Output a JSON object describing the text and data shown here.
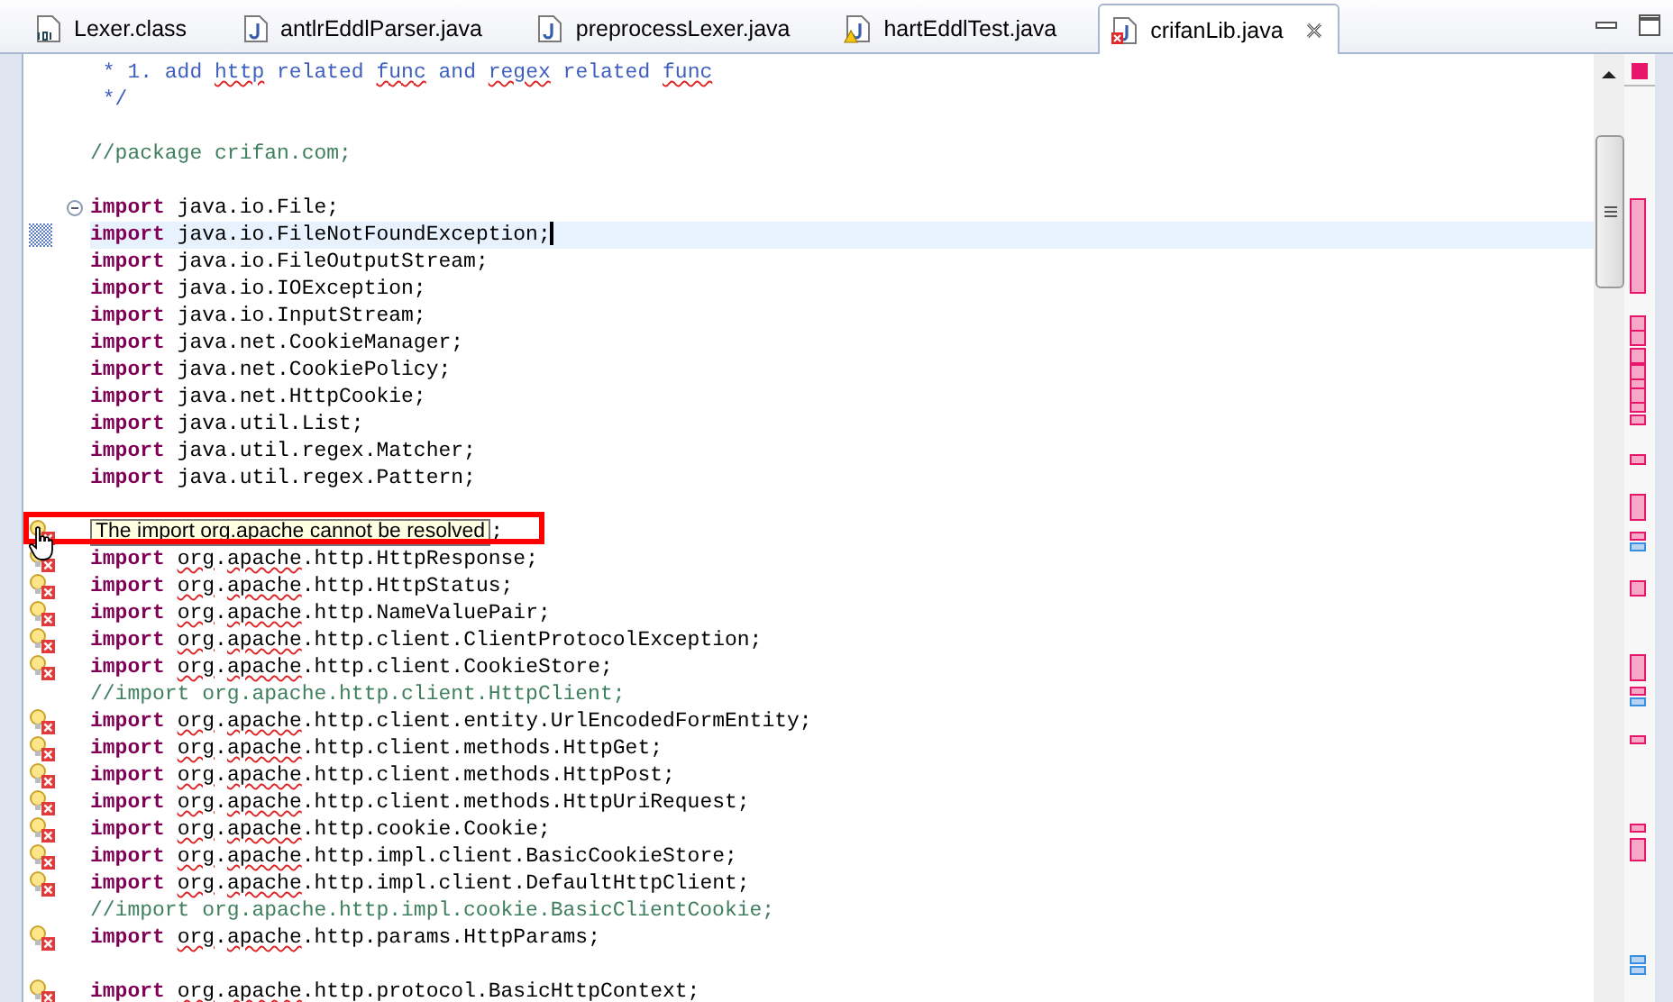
{
  "tabs": [
    {
      "label": "Lexer.class",
      "kind": "class",
      "selected": false
    },
    {
      "label": "antlrEddlParser.java",
      "kind": "java",
      "selected": false
    },
    {
      "label": "preprocessLexer.java",
      "kind": "java",
      "selected": false
    },
    {
      "label": "hartEddlTest.java",
      "kind": "java_warning",
      "selected": false
    },
    {
      "label": "crifanLib.java",
      "kind": "java_error",
      "selected": true
    }
  ],
  "editor": {
    "lines": [
      {
        "kind": "code",
        "current": false,
        "segments": [
          {
            "text": " * 1. add ",
            "kind": "doc"
          },
          {
            "text": "http",
            "kind": "doc_misspelled"
          },
          {
            "text": " related ",
            "kind": "doc"
          },
          {
            "text": "func",
            "kind": "doc_misspelled"
          },
          {
            "text": " and ",
            "kind": "doc"
          },
          {
            "text": "regex",
            "kind": "doc_misspelled"
          },
          {
            "text": " related ",
            "kind": "doc"
          },
          {
            "text": "func",
            "kind": "doc_misspelled"
          }
        ]
      },
      {
        "kind": "code",
        "current": false,
        "segments": [
          {
            "text": " */",
            "kind": "doc"
          }
        ]
      },
      {
        "kind": "blank",
        "current": false
      },
      {
        "kind": "code",
        "current": false,
        "segments": [
          {
            "text": "//package crifan.com;",
            "kind": "comment"
          }
        ]
      },
      {
        "kind": "blank",
        "current": false
      },
      {
        "kind": "code",
        "current": false,
        "gutter": {
          "kind": "fold"
        },
        "segments": [
          {
            "text": "import ",
            "kind": "keyword"
          },
          {
            "text": "java.io.File;",
            "kind": "plain"
          }
        ]
      },
      {
        "kind": "code",
        "current": true,
        "gutter": {
          "kind": "changed"
        },
        "segments": [
          {
            "text": "import ",
            "kind": "keyword"
          },
          {
            "text": "java.io.FileNotFoundException;",
            "kind": "plain"
          }
        ]
      },
      {
        "kind": "code",
        "current": false,
        "segments": [
          {
            "text": "import ",
            "kind": "keyword"
          },
          {
            "text": "java.io.FileOutputStream;",
            "kind": "plain"
          }
        ]
      },
      {
        "kind": "code",
        "current": false,
        "segments": [
          {
            "text": "import ",
            "kind": "keyword"
          },
          {
            "text": "java.io.IOException;",
            "kind": "plain"
          }
        ]
      },
      {
        "kind": "code",
        "current": false,
        "segments": [
          {
            "text": "import ",
            "kind": "keyword"
          },
          {
            "text": "java.io.InputStream;",
            "kind": "plain"
          }
        ]
      },
      {
        "kind": "code",
        "current": false,
        "segments": [
          {
            "text": "import ",
            "kind": "keyword"
          },
          {
            "text": "java.net.CookieManager;",
            "kind": "plain"
          }
        ]
      },
      {
        "kind": "code",
        "current": false,
        "segments": [
          {
            "text": "import ",
            "kind": "keyword"
          },
          {
            "text": "java.net.CookiePolicy;",
            "kind": "plain"
          }
        ]
      },
      {
        "kind": "code",
        "current": false,
        "segments": [
          {
            "text": "import ",
            "kind": "keyword"
          },
          {
            "text": "java.net.HttpCookie;",
            "kind": "plain"
          }
        ]
      },
      {
        "kind": "code",
        "current": false,
        "segments": [
          {
            "text": "import ",
            "kind": "keyword"
          },
          {
            "text": "java.util.List;",
            "kind": "plain"
          }
        ]
      },
      {
        "kind": "code",
        "current": false,
        "segments": [
          {
            "text": "import ",
            "kind": "keyword"
          },
          {
            "text": "java.util.regex.Matcher;",
            "kind": "plain"
          }
        ]
      },
      {
        "kind": "code",
        "current": false,
        "segments": [
          {
            "text": "import ",
            "kind": "keyword"
          },
          {
            "text": "java.util.regex.Pattern;",
            "kind": "plain"
          }
        ]
      },
      {
        "kind": "blank",
        "current": false
      },
      {
        "kind": "tooltip",
        "current": false,
        "gutter": {
          "kind": "error"
        },
        "tooltip": "The import org.apache cannot be resolved",
        "segments": [
          {
            "text": ";",
            "kind": "plain"
          }
        ]
      },
      {
        "kind": "code",
        "current": false,
        "gutter": {
          "kind": "error"
        },
        "segments": [
          {
            "text": "import ",
            "kind": "keyword"
          },
          {
            "text": "org",
            "kind": "misspelled"
          },
          {
            "text": ".",
            "kind": "plain"
          },
          {
            "text": "apache",
            "kind": "misspelled"
          },
          {
            "text": ".http.HttpResponse;",
            "kind": "plain"
          }
        ]
      },
      {
        "kind": "code",
        "current": false,
        "gutter": {
          "kind": "error"
        },
        "segments": [
          {
            "text": "import ",
            "kind": "keyword"
          },
          {
            "text": "org",
            "kind": "misspelled"
          },
          {
            "text": ".",
            "kind": "plain"
          },
          {
            "text": "apache",
            "kind": "misspelled"
          },
          {
            "text": ".http.HttpStatus;",
            "kind": "plain"
          }
        ]
      },
      {
        "kind": "code",
        "current": false,
        "gutter": {
          "kind": "error"
        },
        "segments": [
          {
            "text": "import ",
            "kind": "keyword"
          },
          {
            "text": "org",
            "kind": "misspelled"
          },
          {
            "text": ".",
            "kind": "plain"
          },
          {
            "text": "apache",
            "kind": "misspelled"
          },
          {
            "text": ".http.NameValuePair;",
            "kind": "plain"
          }
        ]
      },
      {
        "kind": "code",
        "current": false,
        "gutter": {
          "kind": "error"
        },
        "segments": [
          {
            "text": "import ",
            "kind": "keyword"
          },
          {
            "text": "org",
            "kind": "misspelled"
          },
          {
            "text": ".",
            "kind": "plain"
          },
          {
            "text": "apache",
            "kind": "misspelled"
          },
          {
            "text": ".http.client.ClientProtocolException;",
            "kind": "plain"
          }
        ]
      },
      {
        "kind": "code",
        "current": false,
        "gutter": {
          "kind": "error"
        },
        "segments": [
          {
            "text": "import ",
            "kind": "keyword"
          },
          {
            "text": "org",
            "kind": "misspelled"
          },
          {
            "text": ".",
            "kind": "plain"
          },
          {
            "text": "apache",
            "kind": "misspelled"
          },
          {
            "text": ".http.client.CookieStore;",
            "kind": "plain"
          }
        ]
      },
      {
        "kind": "code",
        "current": false,
        "segments": [
          {
            "text": "//import org.apache.http.client.HttpClient;",
            "kind": "comment"
          }
        ]
      },
      {
        "kind": "code",
        "current": false,
        "gutter": {
          "kind": "error"
        },
        "segments": [
          {
            "text": "import ",
            "kind": "keyword"
          },
          {
            "text": "org",
            "kind": "misspelled"
          },
          {
            "text": ".",
            "kind": "plain"
          },
          {
            "text": "apache",
            "kind": "misspelled"
          },
          {
            "text": ".http.client.entity.UrlEncodedFormEntity;",
            "kind": "plain"
          }
        ]
      },
      {
        "kind": "code",
        "current": false,
        "gutter": {
          "kind": "error"
        },
        "segments": [
          {
            "text": "import ",
            "kind": "keyword"
          },
          {
            "text": "org",
            "kind": "misspelled"
          },
          {
            "text": ".",
            "kind": "plain"
          },
          {
            "text": "apache",
            "kind": "misspelled"
          },
          {
            "text": ".http.client.methods.HttpGet;",
            "kind": "plain"
          }
        ]
      },
      {
        "kind": "code",
        "current": false,
        "gutter": {
          "kind": "error"
        },
        "segments": [
          {
            "text": "import ",
            "kind": "keyword"
          },
          {
            "text": "org",
            "kind": "misspelled"
          },
          {
            "text": ".",
            "kind": "plain"
          },
          {
            "text": "apache",
            "kind": "misspelled"
          },
          {
            "text": ".http.client.methods.HttpPost;",
            "kind": "plain"
          }
        ]
      },
      {
        "kind": "code",
        "current": false,
        "gutter": {
          "kind": "error"
        },
        "segments": [
          {
            "text": "import ",
            "kind": "keyword"
          },
          {
            "text": "org",
            "kind": "misspelled"
          },
          {
            "text": ".",
            "kind": "plain"
          },
          {
            "text": "apache",
            "kind": "misspelled"
          },
          {
            "text": ".http.client.methods.HttpUriRequest;",
            "kind": "plain"
          }
        ]
      },
      {
        "kind": "code",
        "current": false,
        "gutter": {
          "kind": "error"
        },
        "segments": [
          {
            "text": "import ",
            "kind": "keyword"
          },
          {
            "text": "org",
            "kind": "misspelled"
          },
          {
            "text": ".",
            "kind": "plain"
          },
          {
            "text": "apache",
            "kind": "misspelled"
          },
          {
            "text": ".http.cookie.Cookie;",
            "kind": "plain"
          }
        ]
      },
      {
        "kind": "code",
        "current": false,
        "gutter": {
          "kind": "error"
        },
        "segments": [
          {
            "text": "import ",
            "kind": "keyword"
          },
          {
            "text": "org",
            "kind": "misspelled"
          },
          {
            "text": ".",
            "kind": "plain"
          },
          {
            "text": "apache",
            "kind": "misspelled"
          },
          {
            "text": ".http.impl.client.BasicCookieStore;",
            "kind": "plain"
          }
        ]
      },
      {
        "kind": "code",
        "current": false,
        "gutter": {
          "kind": "error"
        },
        "segments": [
          {
            "text": "import ",
            "kind": "keyword"
          },
          {
            "text": "org",
            "kind": "misspelled"
          },
          {
            "text": ".",
            "kind": "plain"
          },
          {
            "text": "apache",
            "kind": "misspelled"
          },
          {
            "text": ".http.impl.client.DefaultHttpClient;",
            "kind": "plain"
          }
        ]
      },
      {
        "kind": "code",
        "current": false,
        "segments": [
          {
            "text": "//import org.apache.http.impl.cookie.BasicClientCookie;",
            "kind": "comment"
          }
        ]
      },
      {
        "kind": "code",
        "current": false,
        "gutter": {
          "kind": "error"
        },
        "segments": [
          {
            "text": "import ",
            "kind": "keyword"
          },
          {
            "text": "org",
            "kind": "misspelled"
          },
          {
            "text": ".",
            "kind": "plain"
          },
          {
            "text": "apache",
            "kind": "misspelled"
          },
          {
            "text": ".http.params.HttpParams;",
            "kind": "plain"
          }
        ]
      },
      {
        "kind": "blank",
        "current": false
      },
      {
        "kind": "code",
        "current": false,
        "gutter": {
          "kind": "error"
        },
        "segments": [
          {
            "text": "import ",
            "kind": "keyword"
          },
          {
            "text": "org",
            "kind": "misspelled"
          },
          {
            "text": ".",
            "kind": "plain"
          },
          {
            "text": "apache",
            "kind": "misspelled"
          },
          {
            "text": ".http.protocol.BasicHttpContext;",
            "kind": "plain"
          }
        ]
      }
    ]
  }
}
